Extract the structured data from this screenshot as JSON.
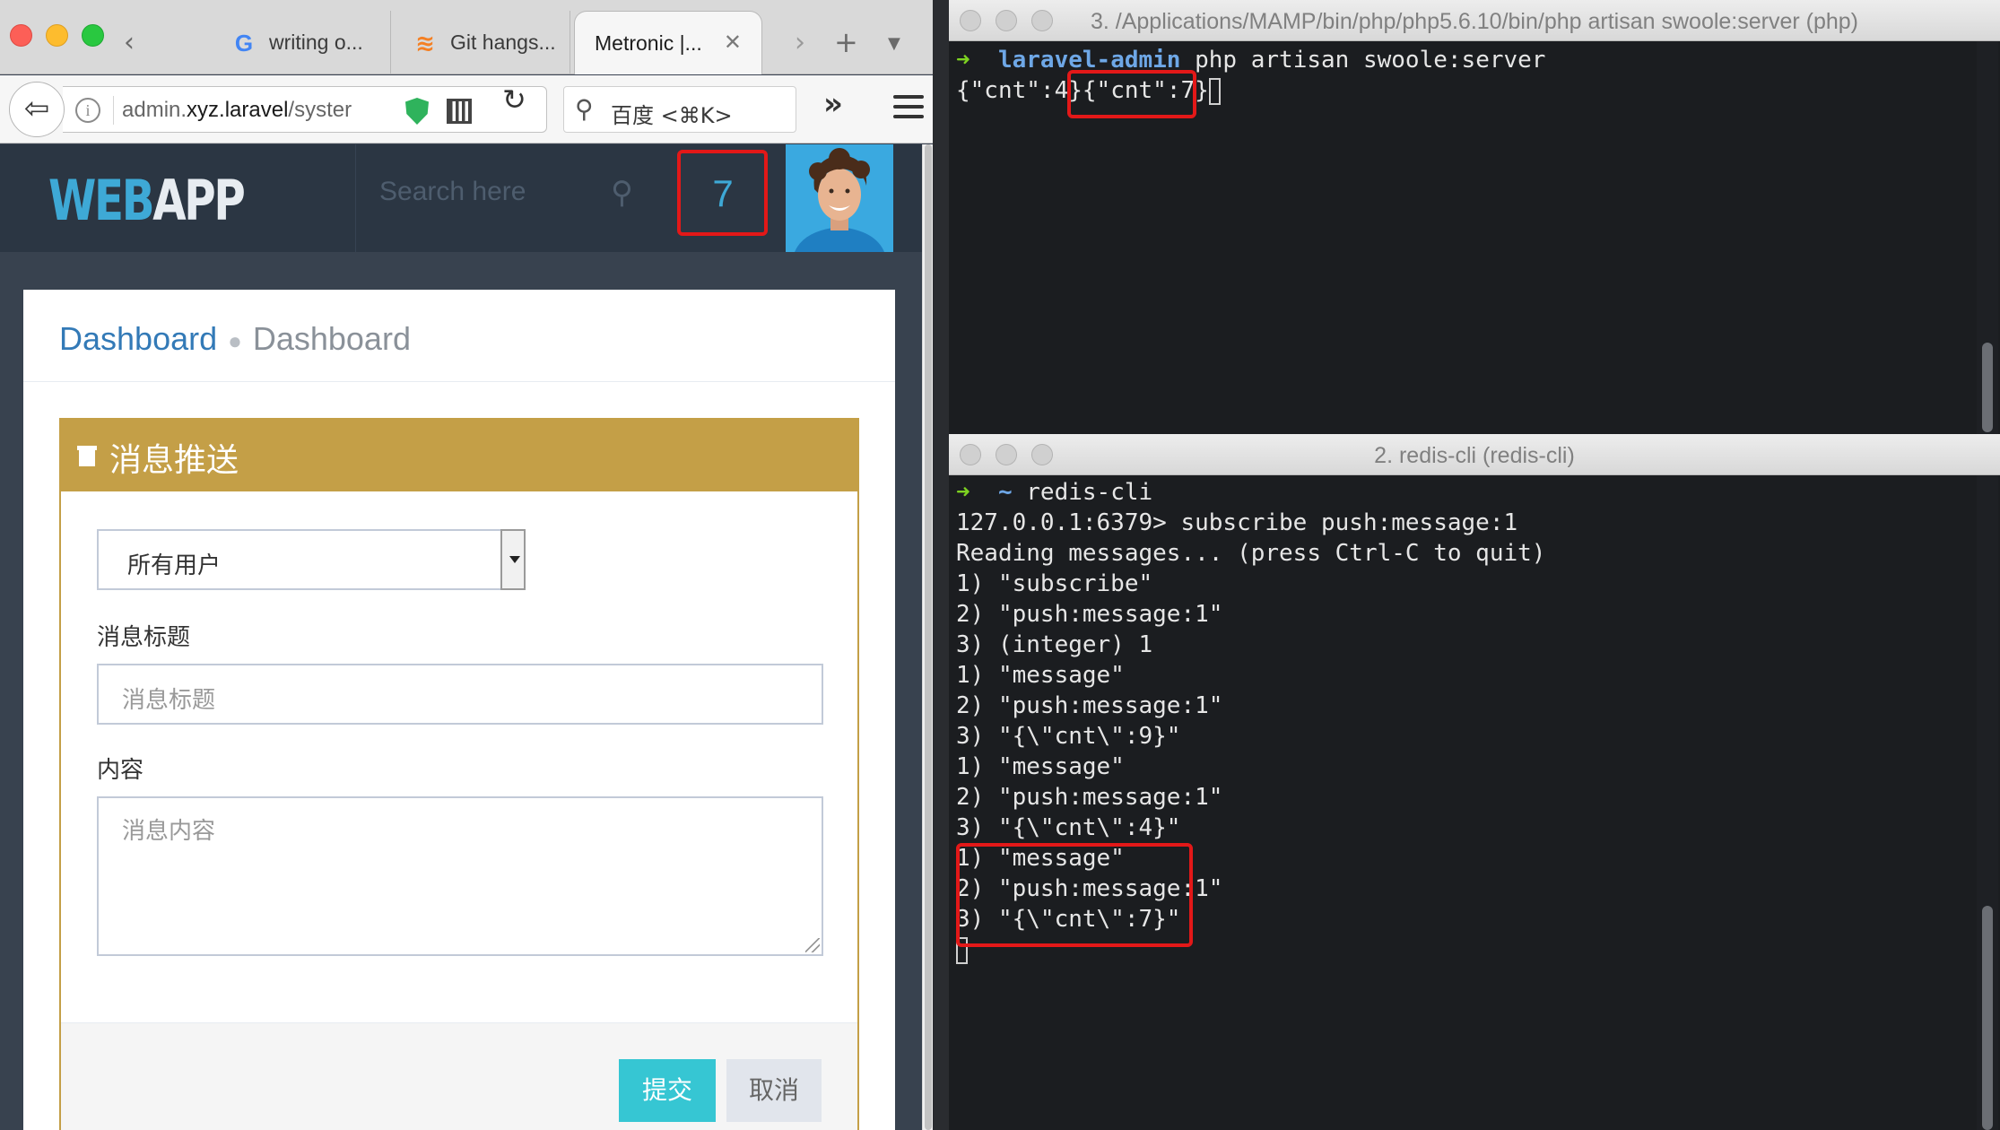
{
  "browser": {
    "tabs": [
      {
        "label": "writing o...",
        "icon": "google-icon"
      },
      {
        "label": "Git hangs...",
        "icon": "stackoverflow-icon"
      },
      {
        "label": "Metronic |...",
        "icon": "none",
        "active": true
      }
    ],
    "url_prefix": "admin.",
    "url_host": "xyz.laravel",
    "url_suffix": "/syster",
    "search_placeholder": "百度 <⌘K>"
  },
  "app": {
    "logo_part1": "WEB",
    "logo_part2": "APP",
    "header_search_placeholder": "Search here",
    "notification_count": "7",
    "breadcrumb_link": "Dashboard",
    "breadcrumb_current": "Dashboard",
    "portlet_title": "消息推送",
    "target_select_value": "所有用户",
    "title_label": "消息标题",
    "title_placeholder": "消息标题",
    "content_label": "内容",
    "content_placeholder": "消息内容",
    "submit_label": "提交",
    "cancel_label": "取消"
  },
  "terminal_top": {
    "title": "3. /Applications/MAMP/bin/php/php5.6.10/bin/php artisan swoole:server (php)",
    "prompt_arrow": "➜",
    "prompt_dir": "laravel-admin",
    "command": "php artisan swoole:server",
    "output_a": "{\"cnt\":4}",
    "output_b": "{\"cnt\":7}"
  },
  "terminal_bottom": {
    "title": "2. redis-cli (redis-cli)",
    "prompt_arrow": "➜",
    "prompt_dir": "~",
    "command": "redis-cli",
    "lines": [
      "127.0.0.1:6379> subscribe push:message:1",
      "Reading messages... (press Ctrl-C to quit)",
      "1) \"subscribe\"",
      "2) \"push:message:1\"",
      "3) (integer) 1",
      "1) \"message\"",
      "2) \"push:message:1\"",
      "3) \"{\\\"cnt\\\":9}\"",
      "1) \"message\"",
      "2) \"push:message:1\"",
      "3) \"{\\\"cnt\\\":4}\"",
      "1) \"message\"",
      "2) \"push:message:1\"",
      "3) \"{\\\"cnt\\\":7}\""
    ]
  },
  "colors": {
    "portlet_accent": "#c49f47",
    "submit_button": "#36c6d3",
    "highlight_box": "#e31818",
    "logo_blue": "#3ea9d6",
    "header_bg": "#2b3643"
  }
}
